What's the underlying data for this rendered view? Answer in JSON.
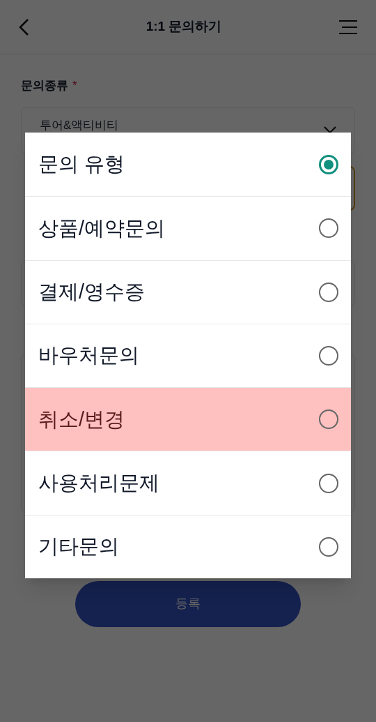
{
  "header": {
    "title": "1:1 문의하기"
  },
  "form": {
    "category_label": "문의종류",
    "required_mark": "*",
    "category_value": "투어&액티비티",
    "submit_button": "등록"
  },
  "dialog": {
    "options": [
      {
        "label": "문의 유형",
        "selected": true,
        "highlighted": false
      },
      {
        "label": "상품/예약문의",
        "selected": false,
        "highlighted": false
      },
      {
        "label": "결제/영수증",
        "selected": false,
        "highlighted": false
      },
      {
        "label": "바우처문의",
        "selected": false,
        "highlighted": false
      },
      {
        "label": "취소/변경",
        "selected": false,
        "highlighted": true
      },
      {
        "label": "사용처리문제",
        "selected": false,
        "highlighted": false
      },
      {
        "label": "기타문의",
        "selected": false,
        "highlighted": false
      }
    ]
  }
}
